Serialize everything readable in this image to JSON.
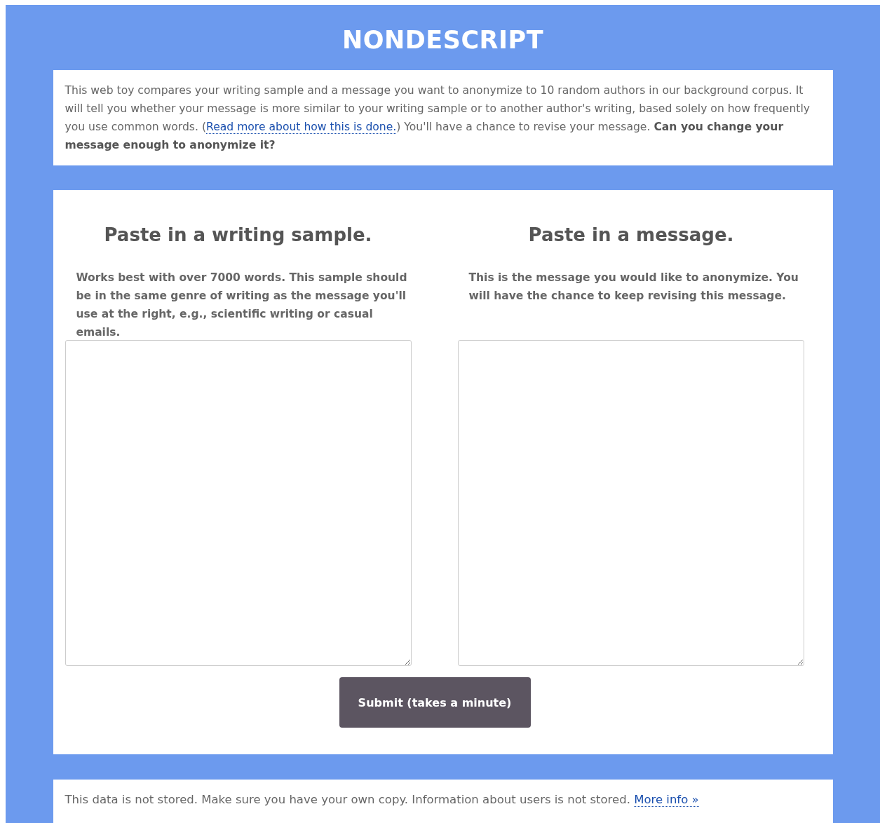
{
  "header": {
    "title": "NONDESCRIPT"
  },
  "intro": {
    "before": "This web toy compares your writing sample and a message you want to anonymize to 10 random authors in our background corpus. It will tell you whether your message is more similar to your writing sample or to another author's writing, based solely on how frequently you use common words. (",
    "link": "Read more about how this is done.",
    "after": ") You'll have a chance to revise your message. **Can you change your message enough to anonymize it?**"
  },
  "columns": [
    {
      "heading": "Paste in a writing sample.",
      "description": "Works best with over 7000 words. This sample should be in the same genre of writing as the message you'll use at the right, e.g., scientific writing or casual emails."
    },
    {
      "heading": "Paste in a message.",
      "description": "This is the message you would like to anonymize. You will have the chance to keep revising this message."
    }
  ],
  "submit": {
    "label": "Submit (takes a minute)"
  },
  "footer": {
    "text": "This data is not stored. Make sure you have your own copy. Information about users is not stored.",
    "link": "More info »"
  }
}
